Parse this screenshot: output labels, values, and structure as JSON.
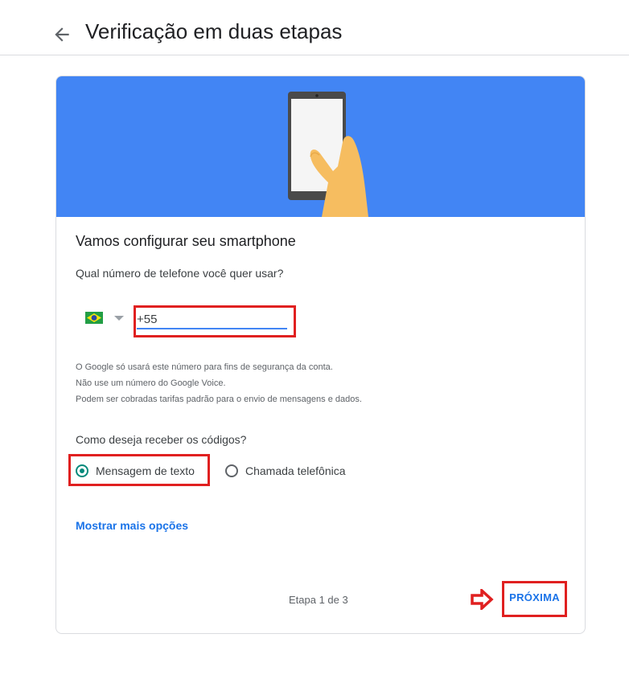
{
  "header": {
    "back_icon": "arrow-left-icon",
    "title": "Verificação em duas etapas"
  },
  "card": {
    "hero_color": "#4285f4",
    "hero_image": "hand-holding-smartphone-illustration",
    "title": "Vamos configurar seu smartphone",
    "phone_question": "Qual número de telefone você quer usar?",
    "country": {
      "flag_icon": "brazil-flag-icon",
      "dropdown_icon": "caret-down-icon"
    },
    "phone_input": {
      "value": "+55"
    },
    "notes": [
      "O Google só usará este número para fins de segurança da conta.",
      "Não use um número do Google Voice.",
      "Podem ser cobradas tarifas padrão para o envio de mensagens e dados."
    ],
    "codes_question": "Como deseja receber os códigos?",
    "options": [
      {
        "label": "Mensagem de texto",
        "selected": true
      },
      {
        "label": "Chamada telefônica",
        "selected": false
      }
    ],
    "more_options_link": "Mostrar mais opções",
    "step_text": "Etapa 1 de 3",
    "next_button": "PRÓXIMA",
    "highlight_color": "#e02020",
    "accent_color": "#1a73e8"
  }
}
